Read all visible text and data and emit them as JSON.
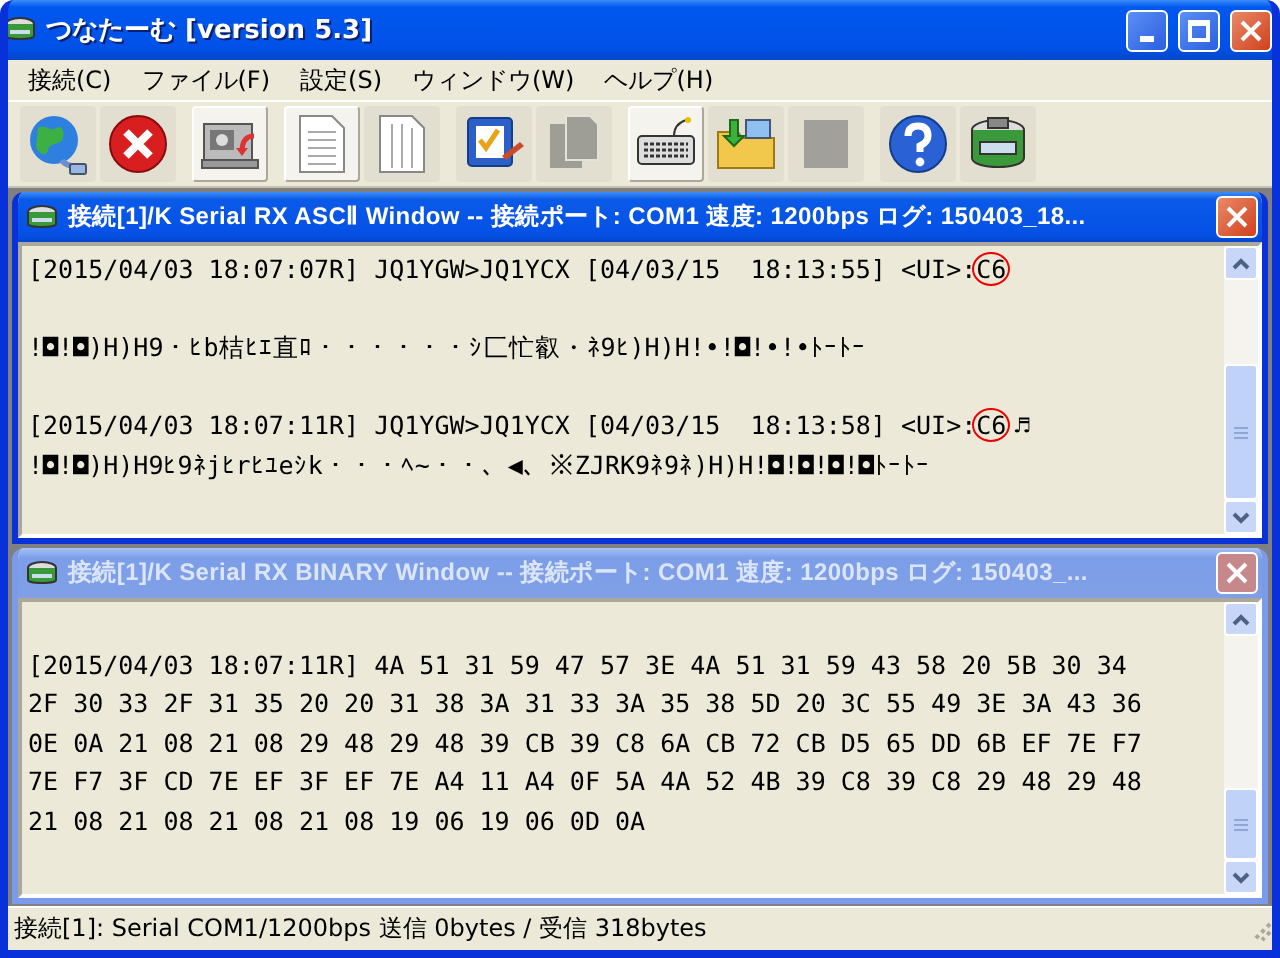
{
  "window": {
    "title": "つなたーむ [version 5.3]"
  },
  "menu": [
    "接続(C)",
    "ファイル(F)",
    "設定(S)",
    "ウィンドウ(W)",
    "ヘルプ(H)"
  ],
  "toolbar": {
    "groups": [
      [
        {
          "kind": "globe",
          "pressed": false,
          "disabled": false
        },
        {
          "kind": "stop",
          "pressed": false,
          "disabled": false
        }
      ],
      [
        {
          "kind": "drive",
          "pressed": true,
          "disabled": false
        }
      ],
      [
        {
          "kind": "page",
          "pressed": true,
          "disabled": false
        },
        {
          "kind": "columns",
          "pressed": false,
          "disabled": false
        }
      ],
      [
        {
          "kind": "checklist",
          "pressed": false,
          "disabled": false
        },
        {
          "kind": "copy",
          "pressed": false,
          "disabled": true
        }
      ],
      [
        {
          "kind": "keyboard",
          "pressed": true,
          "disabled": false
        },
        {
          "kind": "folder",
          "pressed": false,
          "disabled": false
        },
        {
          "kind": "blank",
          "pressed": false,
          "disabled": true
        }
      ],
      [
        {
          "kind": "help",
          "pressed": false,
          "disabled": false
        },
        {
          "kind": "drum",
          "pressed": false,
          "disabled": false
        }
      ]
    ]
  },
  "child_windows": [
    {
      "title": "接続[1]/K Serial RX ASCⅡ Window -- 接続ポート: COM1 速度: 1200bps ログ: 150403_18...",
      "active": true,
      "lines": [
        {
          "kind": "text",
          "text": "[2015/04/03 18:07:07R] JQ1YGW>JQ1YCX [04/03/15  18:13:55] <UI>:",
          "circled": "C6"
        },
        {
          "kind": "blank"
        },
        {
          "kind": "text",
          "text": "!◘!◘)H)H9・ﾋb桔ﾋｴ直ﾛ・・・・・・ｼ匚忙叡・ﾈ9ﾋ)H)H!•!◘!•!•ﾄｰﾄｰ"
        },
        {
          "kind": "blank"
        },
        {
          "kind": "text",
          "text": "[2015/04/03 18:07:11R] JQ1YGW>JQ1YCX [04/03/15  18:13:58] <UI>:",
          "circled": "C6",
          "tail": "♬"
        },
        {
          "kind": "text",
          "text": "!◘!◘)H)H9ﾋ9ﾈjﾋrﾋﾕeｼk・・・ﾍ~・・、◀、※ZJRK9ﾈ9ﾈ)H)H!◘!◘!◘!◘ﾄｰﾄｰ"
        }
      ]
    },
    {
      "title": "接続[1]/K Serial RX BINARY Window -- 接続ポート: COM1 速度: 1200bps ログ: 150403_...",
      "active": false,
      "lines": [
        {
          "kind": "blank"
        },
        {
          "kind": "text",
          "text": "[2015/04/03 18:07:11R] 4A 51 31 59 47 57 3E 4A 51 31 59 43 58 20 5B 30 34"
        },
        {
          "kind": "text",
          "text": "2F 30 33 2F 31 35 20 20 31 38 3A 31 33 3A 35 38 5D 20 3C 55 49 3E 3A 43 36"
        },
        {
          "kind": "text",
          "text": "0E 0A 21 08 21 08 29 48 29 48 39 CB 39 C8 6A CB 72 CB D5 65 DD 6B EF 7E F7"
        },
        {
          "kind": "text",
          "text": "7E F7 3F CD 7E EF 3F EF 7E A4 11 A4 0F 5A 4A 52 4B 39 C8 39 C8 29 48 29 48"
        },
        {
          "kind": "text",
          "text": "21 08 21 08 21 08 21 08 19 06 19 06 0D 0A"
        }
      ]
    }
  ],
  "status_bar": {
    "text": "接続[1]: Serial COM1/1200bps 送信 0bytes / 受信 318bytes"
  }
}
